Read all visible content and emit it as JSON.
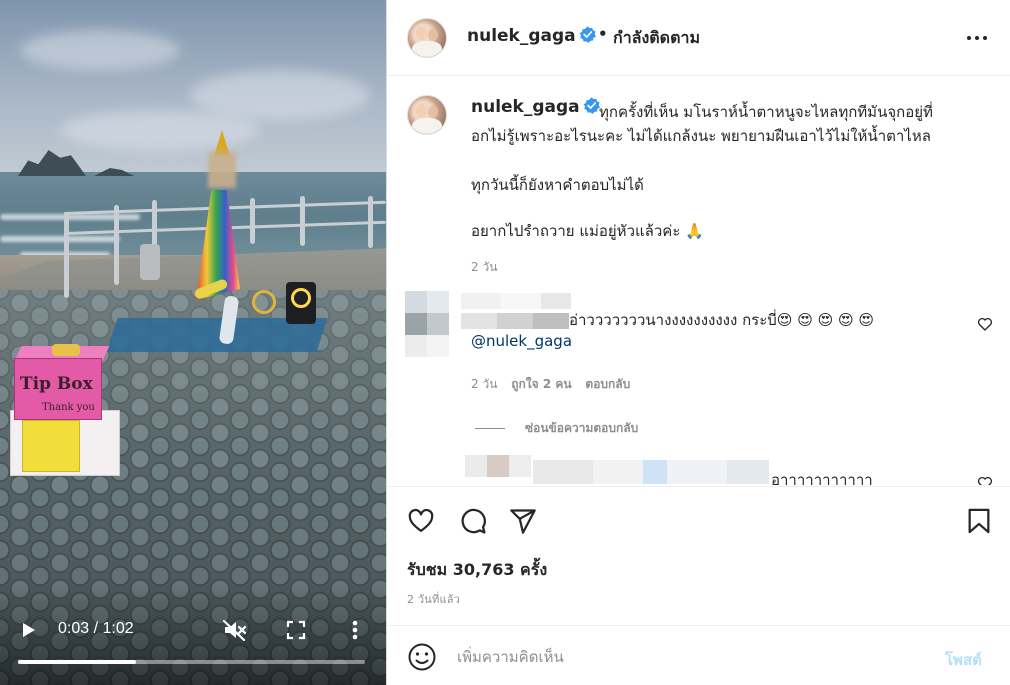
{
  "video": {
    "time_display": "0:03 / 1:02",
    "progress": 0.34,
    "tip_box_title": "Tip Box",
    "tip_box_subtitle": "Thank you",
    "icons": {
      "play": "play-icon",
      "mute": "volume-muted-icon",
      "fullscreen": "fullscreen-icon",
      "more": "vertical-dots-icon"
    }
  },
  "header": {
    "username": "nulek_gaga",
    "separator": "•",
    "following_label": "กำลังติดตาม",
    "more_icon": "horizontal-dots-icon"
  },
  "caption": {
    "username": "nulek_gaga",
    "line1": "ทุกครั้งที่เห็น มโนราห์น้ำตาหนูจะไหลทุกทีมันจุกอยู่ที่",
    "line2": "อกไม่รู้เพราะอะไรนะคะ ไม่ได้แกล้งนะ พยายามฝืนเอาไว้ไม่ให้น้ำตาไหล",
    "line3": "ทุกวันนี้ก็ยังหาคำตอบไม่ได้",
    "line4": "อยากไปรำถวาย แม่อยู่หัวแล้วค่ะ 🙏",
    "time": "2 วัน"
  },
  "comments": [
    {
      "text": "อ่าวววววววนางงงงงงงงงง กระบี่😍 😍 😍 😍 😍",
      "mention": "@nulek_gaga",
      "time": "2 วัน",
      "likes": "ถูกใจ 2 คน",
      "reply_label": "ตอบกลับ"
    },
    {
      "text": "อาาาาาาาาาาา"
    }
  ],
  "hide_replies_label": "ซ่อนข้อความตอบกลับ",
  "actions": {
    "views": "รับชม 30,763 ครั้ง",
    "posted": "2 วันที่แล้ว"
  },
  "add_comment": {
    "placeholder": "เพิ่มความคิดเห็น",
    "post_label": "โพสต์"
  },
  "colors": {
    "verified_blue": "#3897f0",
    "link": "#00376b",
    "muted": "#8e8e8e",
    "post_disabled": "#b2dffc"
  }
}
